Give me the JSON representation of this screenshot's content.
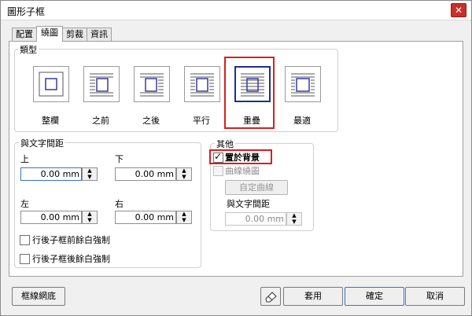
{
  "window": {
    "title": "圖形子框",
    "close_glyph": "✕"
  },
  "tabs": [
    "配置",
    "繞圖",
    "剪裁",
    "資訊"
  ],
  "wrap_type": {
    "label": "類型",
    "options": [
      "整欄",
      "之前",
      "之後",
      "平行",
      "重疊",
      "最適"
    ],
    "selected": "重疊"
  },
  "distance": {
    "label": "與文字間距",
    "top_label": "上",
    "top_value": "0.00 mm",
    "bottom_label": "下",
    "bottom_value": "0.00 mm",
    "left_label": "左",
    "left_value": "0.00 mm",
    "right_label": "右",
    "right_value": "0.00 mm",
    "force_before": "行後子框前餘白強制",
    "force_after": "行後子框後餘白強制"
  },
  "other": {
    "label": "其他",
    "behind": "置於背景",
    "behind_checked": true,
    "curve_wrap": "曲線繞圖",
    "custom_curve": "自定曲線",
    "distance_label": "與文字間距",
    "distance_value": "0.00 mm"
  },
  "footer": {
    "border_shading": "框線網底",
    "eraser_icon": "eraser-icon",
    "apply": "套用",
    "ok": "確定",
    "cancel": "取消"
  },
  "colors": {
    "highlight": "#d81e1e",
    "selected_border": "#1f2f8f"
  }
}
